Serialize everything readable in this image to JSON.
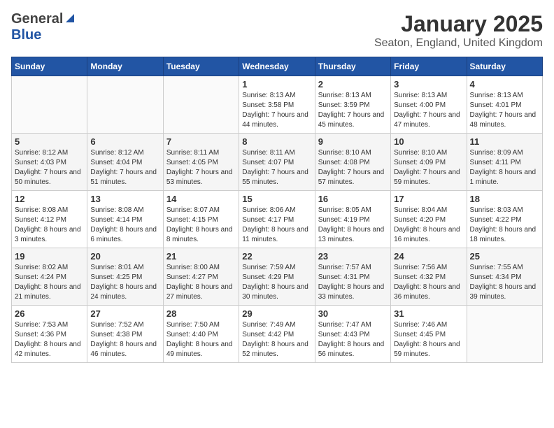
{
  "header": {
    "logo_general": "General",
    "logo_blue": "Blue",
    "month": "January 2025",
    "location": "Seaton, England, United Kingdom"
  },
  "weekdays": [
    "Sunday",
    "Monday",
    "Tuesday",
    "Wednesday",
    "Thursday",
    "Friday",
    "Saturday"
  ],
  "weeks": [
    [
      {
        "day": "",
        "sunrise": "",
        "sunset": "",
        "daylight": ""
      },
      {
        "day": "",
        "sunrise": "",
        "sunset": "",
        "daylight": ""
      },
      {
        "day": "",
        "sunrise": "",
        "sunset": "",
        "daylight": ""
      },
      {
        "day": "1",
        "sunrise": "Sunrise: 8:13 AM",
        "sunset": "Sunset: 3:58 PM",
        "daylight": "Daylight: 7 hours and 44 minutes."
      },
      {
        "day": "2",
        "sunrise": "Sunrise: 8:13 AM",
        "sunset": "Sunset: 3:59 PM",
        "daylight": "Daylight: 7 hours and 45 minutes."
      },
      {
        "day": "3",
        "sunrise": "Sunrise: 8:13 AM",
        "sunset": "Sunset: 4:00 PM",
        "daylight": "Daylight: 7 hours and 47 minutes."
      },
      {
        "day": "4",
        "sunrise": "Sunrise: 8:13 AM",
        "sunset": "Sunset: 4:01 PM",
        "daylight": "Daylight: 7 hours and 48 minutes."
      }
    ],
    [
      {
        "day": "5",
        "sunrise": "Sunrise: 8:12 AM",
        "sunset": "Sunset: 4:03 PM",
        "daylight": "Daylight: 7 hours and 50 minutes."
      },
      {
        "day": "6",
        "sunrise": "Sunrise: 8:12 AM",
        "sunset": "Sunset: 4:04 PM",
        "daylight": "Daylight: 7 hours and 51 minutes."
      },
      {
        "day": "7",
        "sunrise": "Sunrise: 8:11 AM",
        "sunset": "Sunset: 4:05 PM",
        "daylight": "Daylight: 7 hours and 53 minutes."
      },
      {
        "day": "8",
        "sunrise": "Sunrise: 8:11 AM",
        "sunset": "Sunset: 4:07 PM",
        "daylight": "Daylight: 7 hours and 55 minutes."
      },
      {
        "day": "9",
        "sunrise": "Sunrise: 8:10 AM",
        "sunset": "Sunset: 4:08 PM",
        "daylight": "Daylight: 7 hours and 57 minutes."
      },
      {
        "day": "10",
        "sunrise": "Sunrise: 8:10 AM",
        "sunset": "Sunset: 4:09 PM",
        "daylight": "Daylight: 7 hours and 59 minutes."
      },
      {
        "day": "11",
        "sunrise": "Sunrise: 8:09 AM",
        "sunset": "Sunset: 4:11 PM",
        "daylight": "Daylight: 8 hours and 1 minute."
      }
    ],
    [
      {
        "day": "12",
        "sunrise": "Sunrise: 8:08 AM",
        "sunset": "Sunset: 4:12 PM",
        "daylight": "Daylight: 8 hours and 3 minutes."
      },
      {
        "day": "13",
        "sunrise": "Sunrise: 8:08 AM",
        "sunset": "Sunset: 4:14 PM",
        "daylight": "Daylight: 8 hours and 6 minutes."
      },
      {
        "day": "14",
        "sunrise": "Sunrise: 8:07 AM",
        "sunset": "Sunset: 4:15 PM",
        "daylight": "Daylight: 8 hours and 8 minutes."
      },
      {
        "day": "15",
        "sunrise": "Sunrise: 8:06 AM",
        "sunset": "Sunset: 4:17 PM",
        "daylight": "Daylight: 8 hours and 11 minutes."
      },
      {
        "day": "16",
        "sunrise": "Sunrise: 8:05 AM",
        "sunset": "Sunset: 4:19 PM",
        "daylight": "Daylight: 8 hours and 13 minutes."
      },
      {
        "day": "17",
        "sunrise": "Sunrise: 8:04 AM",
        "sunset": "Sunset: 4:20 PM",
        "daylight": "Daylight: 8 hours and 16 minutes."
      },
      {
        "day": "18",
        "sunrise": "Sunrise: 8:03 AM",
        "sunset": "Sunset: 4:22 PM",
        "daylight": "Daylight: 8 hours and 18 minutes."
      }
    ],
    [
      {
        "day": "19",
        "sunrise": "Sunrise: 8:02 AM",
        "sunset": "Sunset: 4:24 PM",
        "daylight": "Daylight: 8 hours and 21 minutes."
      },
      {
        "day": "20",
        "sunrise": "Sunrise: 8:01 AM",
        "sunset": "Sunset: 4:25 PM",
        "daylight": "Daylight: 8 hours and 24 minutes."
      },
      {
        "day": "21",
        "sunrise": "Sunrise: 8:00 AM",
        "sunset": "Sunset: 4:27 PM",
        "daylight": "Daylight: 8 hours and 27 minutes."
      },
      {
        "day": "22",
        "sunrise": "Sunrise: 7:59 AM",
        "sunset": "Sunset: 4:29 PM",
        "daylight": "Daylight: 8 hours and 30 minutes."
      },
      {
        "day": "23",
        "sunrise": "Sunrise: 7:57 AM",
        "sunset": "Sunset: 4:31 PM",
        "daylight": "Daylight: 8 hours and 33 minutes."
      },
      {
        "day": "24",
        "sunrise": "Sunrise: 7:56 AM",
        "sunset": "Sunset: 4:32 PM",
        "daylight": "Daylight: 8 hours and 36 minutes."
      },
      {
        "day": "25",
        "sunrise": "Sunrise: 7:55 AM",
        "sunset": "Sunset: 4:34 PM",
        "daylight": "Daylight: 8 hours and 39 minutes."
      }
    ],
    [
      {
        "day": "26",
        "sunrise": "Sunrise: 7:53 AM",
        "sunset": "Sunset: 4:36 PM",
        "daylight": "Daylight: 8 hours and 42 minutes."
      },
      {
        "day": "27",
        "sunrise": "Sunrise: 7:52 AM",
        "sunset": "Sunset: 4:38 PM",
        "daylight": "Daylight: 8 hours and 46 minutes."
      },
      {
        "day": "28",
        "sunrise": "Sunrise: 7:50 AM",
        "sunset": "Sunset: 4:40 PM",
        "daylight": "Daylight: 8 hours and 49 minutes."
      },
      {
        "day": "29",
        "sunrise": "Sunrise: 7:49 AM",
        "sunset": "Sunset: 4:42 PM",
        "daylight": "Daylight: 8 hours and 52 minutes."
      },
      {
        "day": "30",
        "sunrise": "Sunrise: 7:47 AM",
        "sunset": "Sunset: 4:43 PM",
        "daylight": "Daylight: 8 hours and 56 minutes."
      },
      {
        "day": "31",
        "sunrise": "Sunrise: 7:46 AM",
        "sunset": "Sunset: 4:45 PM",
        "daylight": "Daylight: 8 hours and 59 minutes."
      },
      {
        "day": "",
        "sunrise": "",
        "sunset": "",
        "daylight": ""
      }
    ]
  ]
}
